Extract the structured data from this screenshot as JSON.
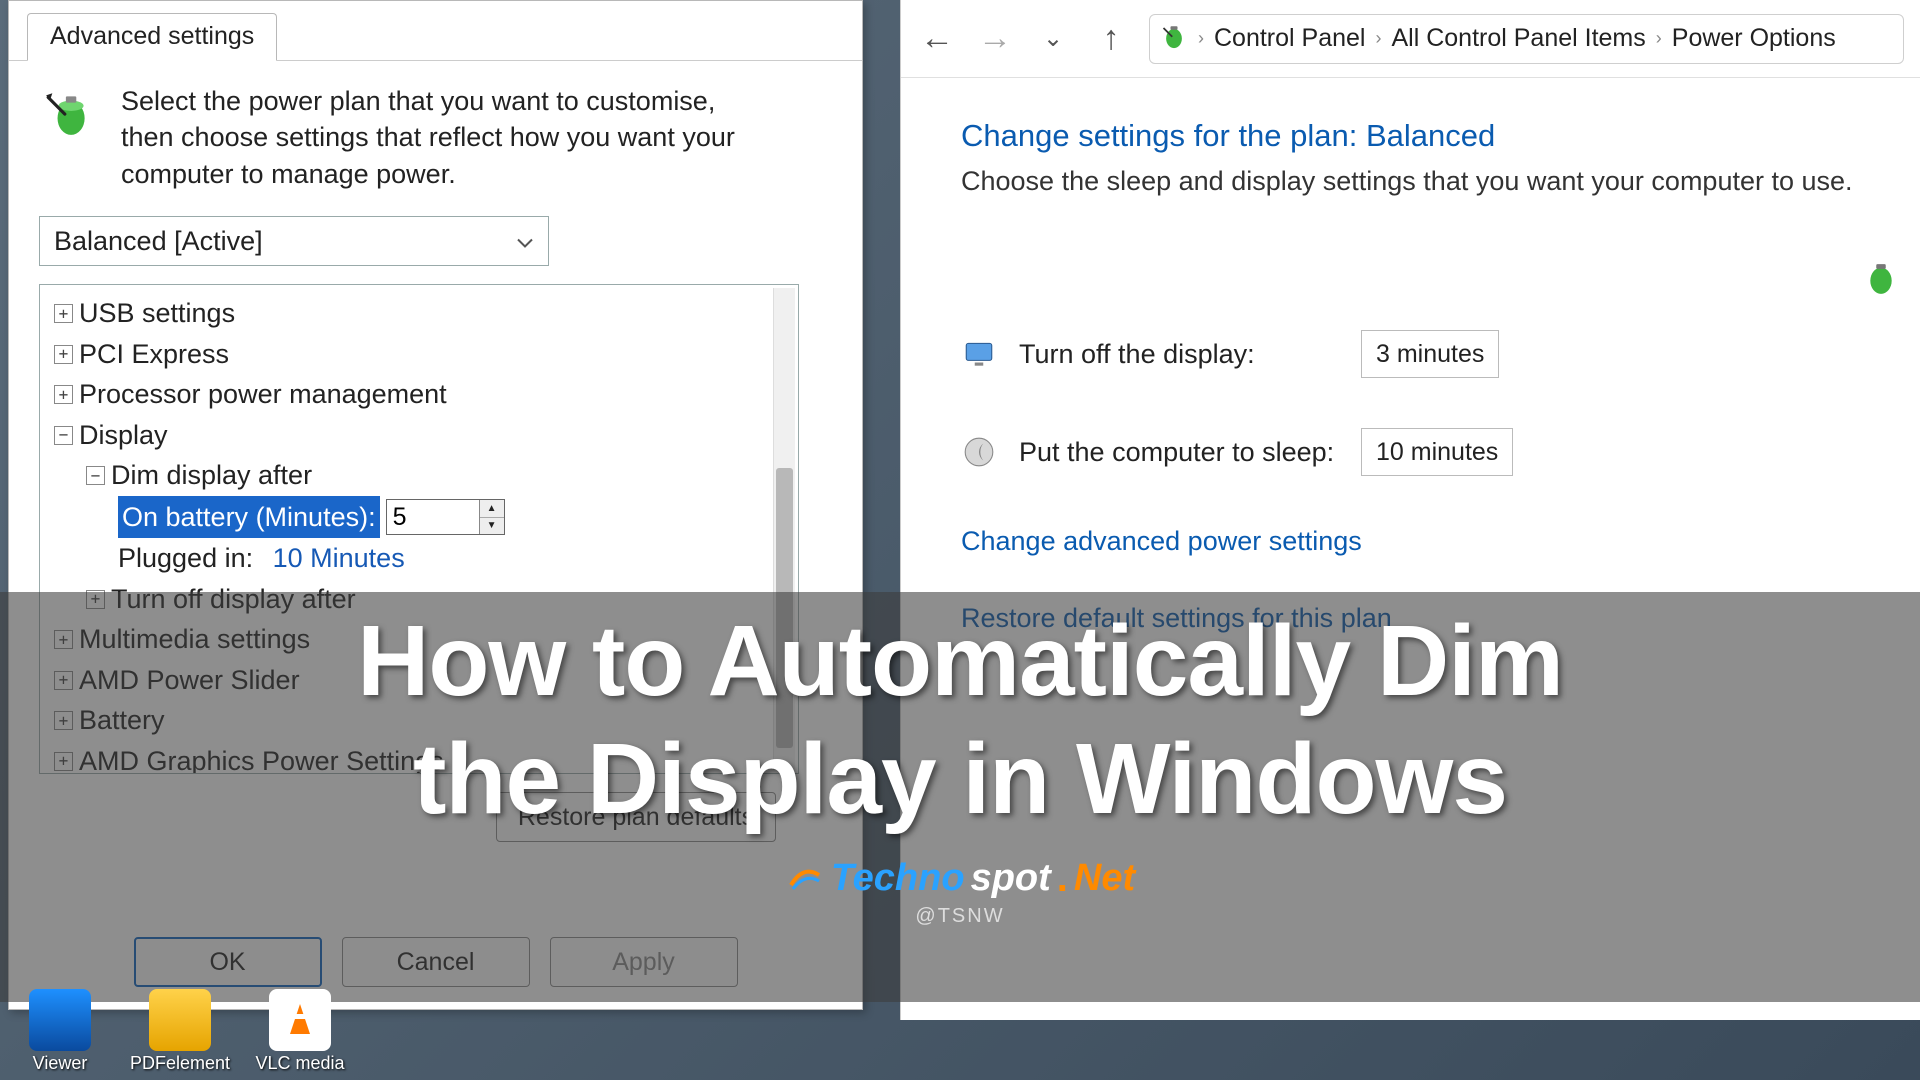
{
  "advanced_dialog": {
    "tab": "Advanced settings",
    "intro": "Select the power plan that you want to customise, then choose settings that reflect how you want your computer to manage power.",
    "plan_selected": "Balanced [Active]",
    "tree": {
      "usb": "USB settings",
      "pci": "PCI Express",
      "ppm": "Processor power management",
      "display": "Display",
      "dim_after": "Dim display after",
      "on_battery_label": "On battery (Minutes):",
      "on_battery_value": "5",
      "plugged_in_label": "Plugged in:",
      "plugged_in_value": "10 Minutes",
      "turnoff_after": "Turn off display after",
      "multimedia": "Multimedia settings",
      "amd_power": "AMD Power Slider",
      "battery": "Battery",
      "amd_graphics": "AMD Graphics Power Settings"
    },
    "restore_btn": "Restore plan defaults",
    "ok": "OK",
    "cancel": "Cancel",
    "apply": "Apply"
  },
  "control_panel": {
    "crumbs": [
      "Control Panel",
      "All Control Panel Items",
      "Power Options"
    ],
    "heading": "Change settings for the plan: Balanced",
    "sub": "Choose the sleep and display settings that you want your computer to use.",
    "turn_off_label": "Turn off the display:",
    "turn_off_value": "3 minutes",
    "sleep_label": "Put the computer to sleep:",
    "sleep_value": "10 minutes",
    "link_advanced": "Change advanced power settings",
    "link_restore": "Restore default settings for this plan"
  },
  "overlay": {
    "title_line1": "How to Automatically Dim",
    "title_line2": "the Display in Windows",
    "brand1": "Techno",
    "brand2": "spot",
    "brand3": "Net",
    "handle": "@TSNW"
  },
  "taskbar": {
    "i1": "Viewer",
    "i2": "PDFelement",
    "i3": "VLC media"
  }
}
